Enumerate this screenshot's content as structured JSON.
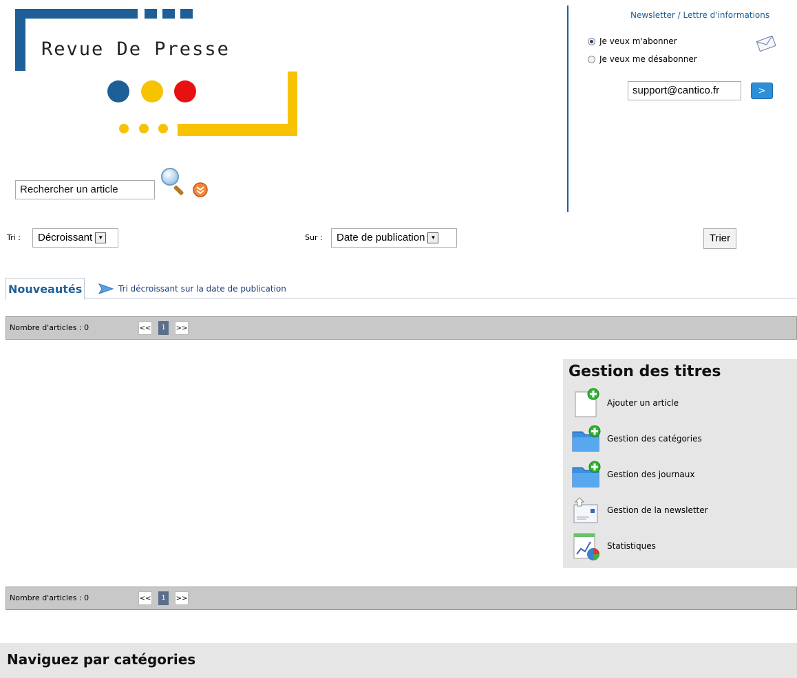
{
  "logo": {
    "title": "Revue De Presse",
    "colors": {
      "blue": "#1d5f96",
      "yellow": "#f7c200",
      "red": "#e81010"
    }
  },
  "search": {
    "placeholder": "Rechercher un article",
    "icon": "magnifier-icon",
    "advanced_icon": "expand-icon"
  },
  "newsletter": {
    "title": "Newsletter / Lettre d'informations",
    "options": [
      {
        "label": "Je veux m'abonner",
        "checked": true
      },
      {
        "label": "Je veux me désabonner",
        "checked": false
      }
    ],
    "email_value": "support@cantico.fr",
    "submit_label": ">",
    "icon": "envelope-icon"
  },
  "sort": {
    "order_label": "Tri :",
    "order_value": "Décroissant",
    "field_label": "Sur :",
    "field_value": "Date de publication",
    "button_label": "Trier"
  },
  "tabs": {
    "active_label": "Nouveautés",
    "info": "Tri décroissant sur la date de publication"
  },
  "pagination": {
    "count_label": "Nombre d'articles : 0",
    "prev": "<<",
    "current": "1",
    "next": ">>"
  },
  "management": {
    "title": "Gestion des titres",
    "items": [
      {
        "label": "Ajouter un article",
        "icon": "add-document-icon"
      },
      {
        "label": "Gestion des catégories",
        "icon": "add-folder-icon"
      },
      {
        "label": "Gestion des journaux",
        "icon": "add-folder-icon"
      },
      {
        "label": "Gestion de la newsletter",
        "icon": "newsletter-icon"
      },
      {
        "label": "Statistiques",
        "icon": "statistics-icon"
      }
    ]
  },
  "categories": {
    "title": "Naviguez par catégories"
  }
}
